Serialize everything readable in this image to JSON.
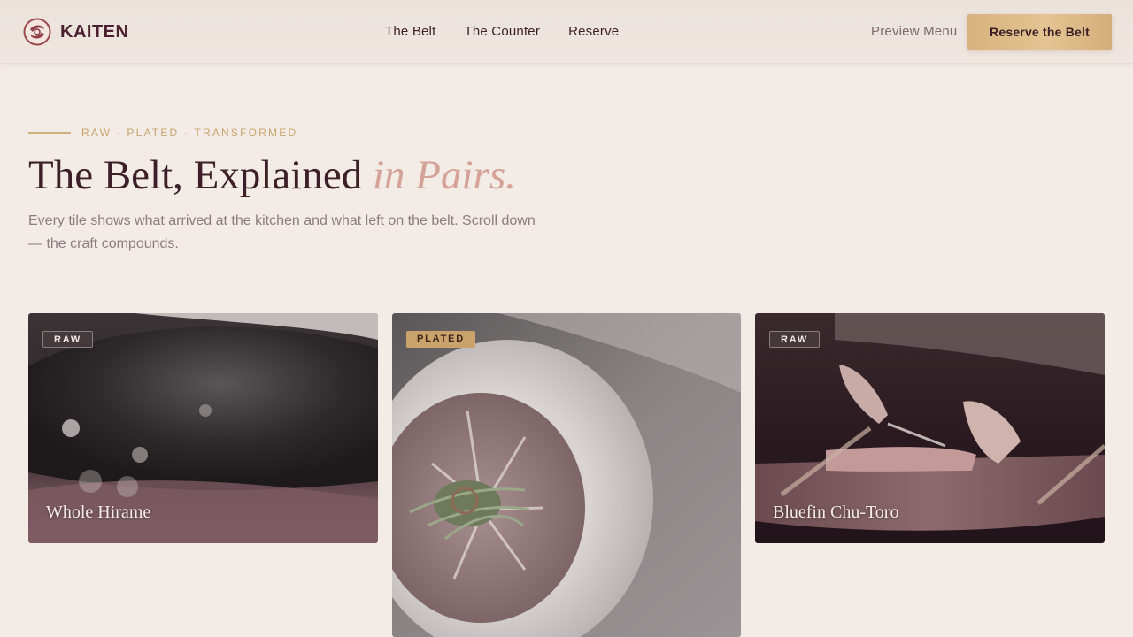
{
  "brand": {
    "name": "KAITEN"
  },
  "nav": {
    "items": [
      "The Belt",
      "The Counter",
      "Reserve"
    ]
  },
  "header": {
    "preview_label": "Preview Menu",
    "cta_label": "Reserve the Belt"
  },
  "hero": {
    "eyebrow": "RAW · PLATED · TRANSFORMED",
    "title_main": "The Belt, Explained ",
    "title_accent": "in Pairs.",
    "subtitle": "Every tile shows what arrived at the kitchen and what left on the belt. Scroll down — the craft compounds."
  },
  "tiles": [
    {
      "badge": "RAW",
      "title": "Whole Hirame"
    },
    {
      "badge": "PLATED",
      "title": ""
    },
    {
      "badge": "RAW",
      "title": "Bluefin Chu-Toro"
    }
  ],
  "colors": {
    "background": "#f3ebe5",
    "ink": "#3c1f28",
    "accent_gold": "#c8a46c",
    "accent_rose": "#d4a296"
  },
  "icons": {
    "brand_mark": "brand-mark-icon"
  }
}
